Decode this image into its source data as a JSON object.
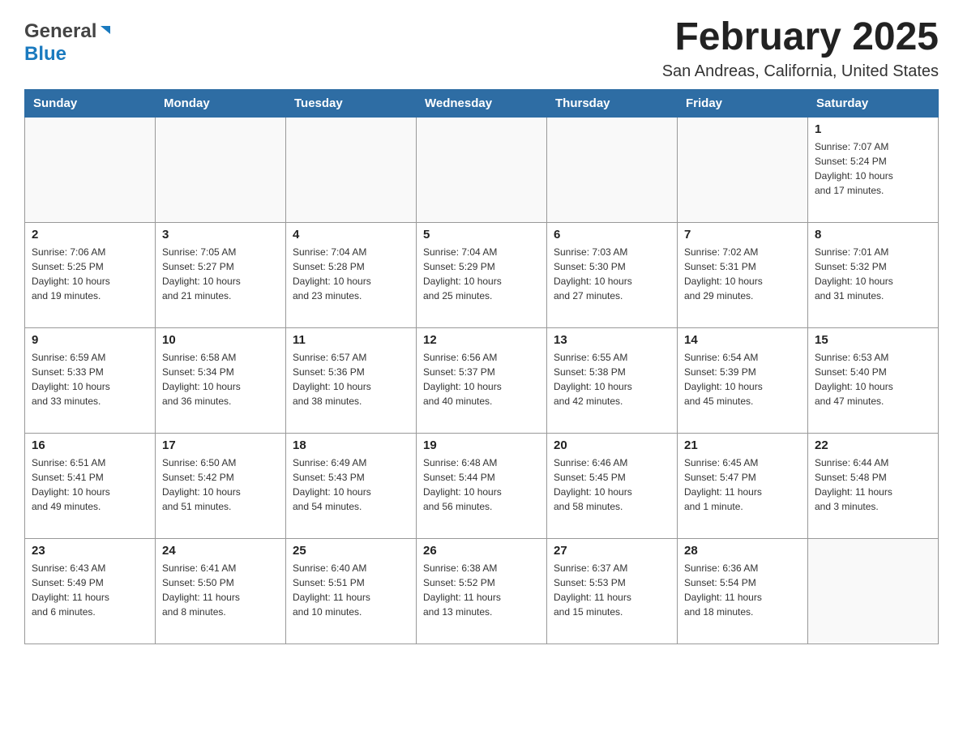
{
  "header": {
    "logo": {
      "general_text": "General",
      "blue_text": "Blue"
    },
    "title": "February 2025",
    "location": "San Andreas, California, United States"
  },
  "days_of_week": [
    "Sunday",
    "Monday",
    "Tuesday",
    "Wednesday",
    "Thursday",
    "Friday",
    "Saturday"
  ],
  "weeks": [
    [
      {
        "day": "",
        "info": ""
      },
      {
        "day": "",
        "info": ""
      },
      {
        "day": "",
        "info": ""
      },
      {
        "day": "",
        "info": ""
      },
      {
        "day": "",
        "info": ""
      },
      {
        "day": "",
        "info": ""
      },
      {
        "day": "1",
        "info": "Sunrise: 7:07 AM\nSunset: 5:24 PM\nDaylight: 10 hours\nand 17 minutes."
      }
    ],
    [
      {
        "day": "2",
        "info": "Sunrise: 7:06 AM\nSunset: 5:25 PM\nDaylight: 10 hours\nand 19 minutes."
      },
      {
        "day": "3",
        "info": "Sunrise: 7:05 AM\nSunset: 5:27 PM\nDaylight: 10 hours\nand 21 minutes."
      },
      {
        "day": "4",
        "info": "Sunrise: 7:04 AM\nSunset: 5:28 PM\nDaylight: 10 hours\nand 23 minutes."
      },
      {
        "day": "5",
        "info": "Sunrise: 7:04 AM\nSunset: 5:29 PM\nDaylight: 10 hours\nand 25 minutes."
      },
      {
        "day": "6",
        "info": "Sunrise: 7:03 AM\nSunset: 5:30 PM\nDaylight: 10 hours\nand 27 minutes."
      },
      {
        "day": "7",
        "info": "Sunrise: 7:02 AM\nSunset: 5:31 PM\nDaylight: 10 hours\nand 29 minutes."
      },
      {
        "day": "8",
        "info": "Sunrise: 7:01 AM\nSunset: 5:32 PM\nDaylight: 10 hours\nand 31 minutes."
      }
    ],
    [
      {
        "day": "9",
        "info": "Sunrise: 6:59 AM\nSunset: 5:33 PM\nDaylight: 10 hours\nand 33 minutes."
      },
      {
        "day": "10",
        "info": "Sunrise: 6:58 AM\nSunset: 5:34 PM\nDaylight: 10 hours\nand 36 minutes."
      },
      {
        "day": "11",
        "info": "Sunrise: 6:57 AM\nSunset: 5:36 PM\nDaylight: 10 hours\nand 38 minutes."
      },
      {
        "day": "12",
        "info": "Sunrise: 6:56 AM\nSunset: 5:37 PM\nDaylight: 10 hours\nand 40 minutes."
      },
      {
        "day": "13",
        "info": "Sunrise: 6:55 AM\nSunset: 5:38 PM\nDaylight: 10 hours\nand 42 minutes."
      },
      {
        "day": "14",
        "info": "Sunrise: 6:54 AM\nSunset: 5:39 PM\nDaylight: 10 hours\nand 45 minutes."
      },
      {
        "day": "15",
        "info": "Sunrise: 6:53 AM\nSunset: 5:40 PM\nDaylight: 10 hours\nand 47 minutes."
      }
    ],
    [
      {
        "day": "16",
        "info": "Sunrise: 6:51 AM\nSunset: 5:41 PM\nDaylight: 10 hours\nand 49 minutes."
      },
      {
        "day": "17",
        "info": "Sunrise: 6:50 AM\nSunset: 5:42 PM\nDaylight: 10 hours\nand 51 minutes."
      },
      {
        "day": "18",
        "info": "Sunrise: 6:49 AM\nSunset: 5:43 PM\nDaylight: 10 hours\nand 54 minutes."
      },
      {
        "day": "19",
        "info": "Sunrise: 6:48 AM\nSunset: 5:44 PM\nDaylight: 10 hours\nand 56 minutes."
      },
      {
        "day": "20",
        "info": "Sunrise: 6:46 AM\nSunset: 5:45 PM\nDaylight: 10 hours\nand 58 minutes."
      },
      {
        "day": "21",
        "info": "Sunrise: 6:45 AM\nSunset: 5:47 PM\nDaylight: 11 hours\nand 1 minute."
      },
      {
        "day": "22",
        "info": "Sunrise: 6:44 AM\nSunset: 5:48 PM\nDaylight: 11 hours\nand 3 minutes."
      }
    ],
    [
      {
        "day": "23",
        "info": "Sunrise: 6:43 AM\nSunset: 5:49 PM\nDaylight: 11 hours\nand 6 minutes."
      },
      {
        "day": "24",
        "info": "Sunrise: 6:41 AM\nSunset: 5:50 PM\nDaylight: 11 hours\nand 8 minutes."
      },
      {
        "day": "25",
        "info": "Sunrise: 6:40 AM\nSunset: 5:51 PM\nDaylight: 11 hours\nand 10 minutes."
      },
      {
        "day": "26",
        "info": "Sunrise: 6:38 AM\nSunset: 5:52 PM\nDaylight: 11 hours\nand 13 minutes."
      },
      {
        "day": "27",
        "info": "Sunrise: 6:37 AM\nSunset: 5:53 PM\nDaylight: 11 hours\nand 15 minutes."
      },
      {
        "day": "28",
        "info": "Sunrise: 6:36 AM\nSunset: 5:54 PM\nDaylight: 11 hours\nand 18 minutes."
      },
      {
        "day": "",
        "info": ""
      }
    ]
  ]
}
